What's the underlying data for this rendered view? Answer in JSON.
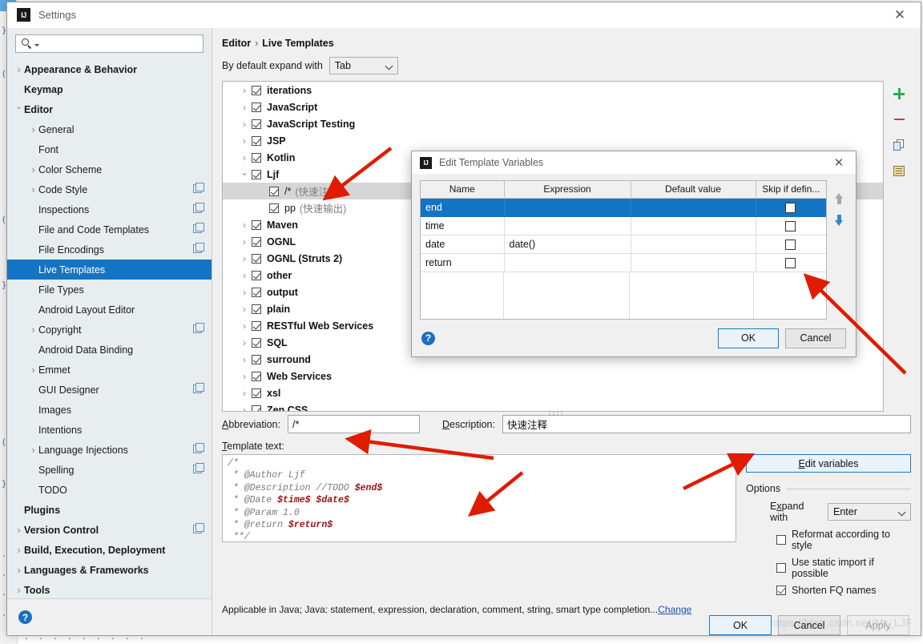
{
  "window": {
    "title": "Settings",
    "logo_text": "IJ",
    "close_icon": "✕"
  },
  "search": {
    "placeholder": "",
    "value": ""
  },
  "sidebar": {
    "items": [
      {
        "label": "Appearance & Behavior",
        "level": 0,
        "bold": true,
        "arrow": "closed",
        "copy": false
      },
      {
        "label": "Keymap",
        "level": 0,
        "bold": true,
        "arrow": "none",
        "copy": false
      },
      {
        "label": "Editor",
        "level": 0,
        "bold": true,
        "arrow": "open",
        "copy": false
      },
      {
        "label": "General",
        "level": 1,
        "bold": false,
        "arrow": "closed",
        "copy": false
      },
      {
        "label": "Font",
        "level": 1,
        "bold": false,
        "arrow": "none",
        "copy": false
      },
      {
        "label": "Color Scheme",
        "level": 1,
        "bold": false,
        "arrow": "closed",
        "copy": false
      },
      {
        "label": "Code Style",
        "level": 1,
        "bold": false,
        "arrow": "closed",
        "copy": true
      },
      {
        "label": "Inspections",
        "level": 1,
        "bold": false,
        "arrow": "none",
        "copy": true
      },
      {
        "label": "File and Code Templates",
        "level": 1,
        "bold": false,
        "arrow": "none",
        "copy": true
      },
      {
        "label": "File Encodings",
        "level": 1,
        "bold": false,
        "arrow": "none",
        "copy": true
      },
      {
        "label": "Live Templates",
        "level": 1,
        "bold": false,
        "arrow": "none",
        "copy": false,
        "selected": true
      },
      {
        "label": "File Types",
        "level": 1,
        "bold": false,
        "arrow": "none",
        "copy": false
      },
      {
        "label": "Android Layout Editor",
        "level": 1,
        "bold": false,
        "arrow": "none",
        "copy": false
      },
      {
        "label": "Copyright",
        "level": 1,
        "bold": false,
        "arrow": "closed",
        "copy": true
      },
      {
        "label": "Android Data Binding",
        "level": 1,
        "bold": false,
        "arrow": "none",
        "copy": false
      },
      {
        "label": "Emmet",
        "level": 1,
        "bold": false,
        "arrow": "closed",
        "copy": false
      },
      {
        "label": "GUI Designer",
        "level": 1,
        "bold": false,
        "arrow": "none",
        "copy": true
      },
      {
        "label": "Images",
        "level": 1,
        "bold": false,
        "arrow": "none",
        "copy": false
      },
      {
        "label": "Intentions",
        "level": 1,
        "bold": false,
        "arrow": "none",
        "copy": false
      },
      {
        "label": "Language Injections",
        "level": 1,
        "bold": false,
        "arrow": "closed",
        "copy": true
      },
      {
        "label": "Spelling",
        "level": 1,
        "bold": false,
        "arrow": "none",
        "copy": true
      },
      {
        "label": "TODO",
        "level": 1,
        "bold": false,
        "arrow": "none",
        "copy": false
      },
      {
        "label": "Plugins",
        "level": 0,
        "bold": true,
        "arrow": "none",
        "copy": false
      },
      {
        "label": "Version Control",
        "level": 0,
        "bold": true,
        "arrow": "closed",
        "copy": true
      },
      {
        "label": "Build, Execution, Deployment",
        "level": 0,
        "bold": true,
        "arrow": "closed",
        "copy": false
      },
      {
        "label": "Languages & Frameworks",
        "level": 0,
        "bold": true,
        "arrow": "closed",
        "copy": false
      },
      {
        "label": "Tools",
        "level": 0,
        "bold": true,
        "arrow": "closed",
        "copy": false
      }
    ],
    "help_label": "?"
  },
  "main": {
    "breadcrumb_root": "Editor",
    "breadcrumb_sep": "›",
    "breadcrumb_leaf": "Live Templates",
    "expand_label": "By default expand with",
    "expand_value": "Tab",
    "tree": [
      {
        "label": "iterations",
        "desc": "",
        "level": 1,
        "arrow": "closed",
        "checked": true,
        "bold": true
      },
      {
        "label": "JavaScript",
        "desc": "",
        "level": 1,
        "arrow": "closed",
        "checked": true,
        "bold": true
      },
      {
        "label": "JavaScript Testing",
        "desc": "",
        "level": 1,
        "arrow": "closed",
        "checked": true,
        "bold": true
      },
      {
        "label": "JSP",
        "desc": "",
        "level": 1,
        "arrow": "closed",
        "checked": true,
        "bold": true
      },
      {
        "label": "Kotlin",
        "desc": "",
        "level": 1,
        "arrow": "closed",
        "checked": true,
        "bold": true
      },
      {
        "label": "Ljf",
        "desc": "",
        "level": 1,
        "arrow": "open",
        "checked": true,
        "bold": true
      },
      {
        "label": "/*",
        "desc": "(快速注释)",
        "level": 2,
        "arrow": "none",
        "checked": true,
        "bold": false,
        "selected": true
      },
      {
        "label": "pp",
        "desc": "(快速输出)",
        "level": 2,
        "arrow": "none",
        "checked": true,
        "bold": false
      },
      {
        "label": "Maven",
        "desc": "",
        "level": 1,
        "arrow": "closed",
        "checked": true,
        "bold": true
      },
      {
        "label": "OGNL",
        "desc": "",
        "level": 1,
        "arrow": "closed",
        "checked": true,
        "bold": true
      },
      {
        "label": "OGNL (Struts 2)",
        "desc": "",
        "level": 1,
        "arrow": "closed",
        "checked": true,
        "bold": true
      },
      {
        "label": "other",
        "desc": "",
        "level": 1,
        "arrow": "closed",
        "checked": true,
        "bold": true
      },
      {
        "label": "output",
        "desc": "",
        "level": 1,
        "arrow": "closed",
        "checked": true,
        "bold": true
      },
      {
        "label": "plain",
        "desc": "",
        "level": 1,
        "arrow": "closed",
        "checked": true,
        "bold": true
      },
      {
        "label": "RESTful Web Services",
        "desc": "",
        "level": 1,
        "arrow": "closed",
        "checked": true,
        "bold": true
      },
      {
        "label": "SQL",
        "desc": "",
        "level": 1,
        "arrow": "closed",
        "checked": true,
        "bold": true
      },
      {
        "label": "surround",
        "desc": "",
        "level": 1,
        "arrow": "closed",
        "checked": true,
        "bold": true
      },
      {
        "label": "Web Services",
        "desc": "",
        "level": 1,
        "arrow": "closed",
        "checked": true,
        "bold": true
      },
      {
        "label": "xsl",
        "desc": "",
        "level": 1,
        "arrow": "closed",
        "checked": true,
        "bold": true
      },
      {
        "label": "Zen CSS",
        "desc": "",
        "level": 1,
        "arrow": "closed",
        "checked": true,
        "bold": true
      }
    ],
    "toolbar": {
      "add_icon": "add-icon",
      "remove_icon": "remove-icon",
      "duplicate_icon": "duplicate-icon",
      "group_icon": "template-group-icon"
    },
    "abbreviation_label": "Abbreviation:",
    "abbreviation_label_mnemonic": "A",
    "abbreviation_value": "/*",
    "description_label": "Description:",
    "description_label_mnemonic": "D",
    "description_value": "快速注释",
    "template_text_label": "Template text:",
    "template_text_label_mnemonic": "T",
    "template_lines": [
      {
        "plain": "/*"
      },
      {
        "plain": " * @Author Ljf"
      },
      {
        "plain": " * @Description //TODO ",
        "var": "$end$"
      },
      {
        "plain": " * @Date ",
        "var": "$time$ $date$"
      },
      {
        "plain": " * @Param 1.0"
      },
      {
        "plain": " * @return ",
        "var": "$return$"
      },
      {
        "plain": " **/"
      }
    ],
    "edit_variables_label": "Edit variables",
    "edit_variables_mnemonic": "E",
    "options_legend": "Options",
    "expand_with_label": "Expand with",
    "expand_with_mnemonic": "x",
    "expand_with_value": "Enter",
    "option_checks": [
      {
        "label": "Reformat according to style",
        "mnemonic": "R",
        "checked": false
      },
      {
        "label": "Use static import if possible",
        "mnemonic": "i",
        "checked": false
      },
      {
        "label": "Shorten FQ names",
        "mnemonic": "FQ",
        "checked": true
      }
    ],
    "applicable_text": "Applicable in Java; Java: statement, expression, declaration, comment, string, smart type completion...",
    "applicable_link": "Change",
    "buttons": {
      "ok": "OK",
      "cancel": "Cancel",
      "apply": "Apply"
    },
    "watermark": "https://blog.csdn.net/Mr_LJF"
  },
  "dialog": {
    "title": "Edit Template Variables",
    "logo_text": "IJ",
    "close_icon": "✕",
    "columns": [
      "Name",
      "Expression",
      "Default value",
      "Skip if defin..."
    ],
    "rows": [
      {
        "name": "end",
        "expression": "",
        "default": "",
        "skip": false,
        "selected": true
      },
      {
        "name": "time",
        "expression": "",
        "default": "",
        "skip": false
      },
      {
        "name": "date",
        "expression": "date()",
        "default": "",
        "skip": false
      },
      {
        "name": "return",
        "expression": "",
        "default": "",
        "skip": false
      }
    ],
    "move_up_icon": "arrow-up-icon",
    "move_down_icon": "arrow-down-icon",
    "help_label": "?",
    "buttons": {
      "ok": "OK",
      "cancel": "Cancel"
    }
  },
  "colors": {
    "accent": "#1474c4",
    "sidebar_bg": "#e8edf0",
    "variable_red": "#a01010",
    "annotation_red": "#e01b00",
    "add_green": "#2faa4b",
    "remove_red": "#cc3b33"
  },
  "backdrop": {
    "code_fragments": [
      "}",
      "*",
      "{",
      "o",
      "}",
      "."
    ]
  }
}
